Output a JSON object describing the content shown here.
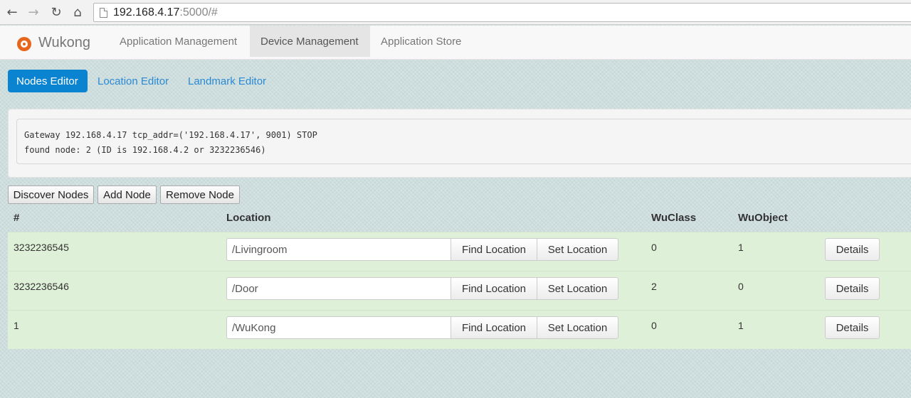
{
  "browser": {
    "url_host": "192.168.4.17",
    "url_rest": ":5000/#",
    "back_icon": "back-arrow-icon",
    "forward_icon": "forward-arrow-icon",
    "reload_icon": "reload-icon",
    "home_icon": "home-icon"
  },
  "navbar": {
    "brand": "Wukong",
    "items": [
      {
        "label": "Application Management"
      },
      {
        "label": "Device Management"
      },
      {
        "label": "Application Store"
      }
    ],
    "active_index": 1
  },
  "subtabs": [
    {
      "label": "Nodes Editor"
    },
    {
      "label": "Location Editor"
    },
    {
      "label": "Landmark Editor"
    }
  ],
  "console": {
    "lines": [
      "Gateway 192.168.4.17 tcp_addr=('192.168.4.17', 9001) STOP",
      "found node: 2 (ID is 192.168.4.2 or 3232236546)"
    ]
  },
  "actions": {
    "discover": "Discover Nodes",
    "add": "Add Node",
    "remove": "Remove Node"
  },
  "table": {
    "headers": {
      "id": "#",
      "location": "Location",
      "wuclass": "WuClass",
      "wuobject": "WuObject"
    },
    "find_label": "Find Location",
    "set_label": "Set Location",
    "details_label": "Details",
    "rows": [
      {
        "id": "3232236545",
        "location": "/Livingroom",
        "wuclass": "0",
        "wuobject": "1"
      },
      {
        "id": "3232236546",
        "location": "/Door",
        "wuclass": "2",
        "wuobject": "0"
      },
      {
        "id": "1",
        "location": "/WuKong",
        "wuclass": "0",
        "wuobject": "1"
      }
    ]
  },
  "colors": {
    "accent": "#0a84d0",
    "row_bg": "#dff0d8",
    "brand_orange": "#e8661c"
  }
}
